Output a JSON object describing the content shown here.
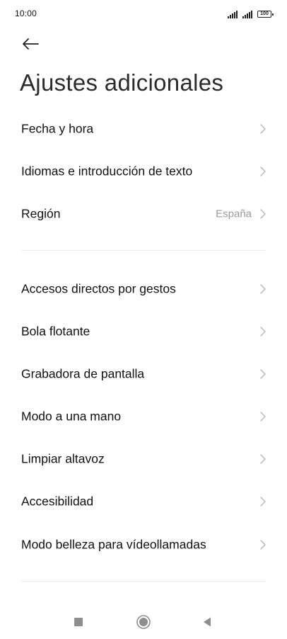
{
  "status_bar": {
    "time": "10:00",
    "battery_level": "100",
    "icons": [
      "signal-icon",
      "signal-icon",
      "battery-icon"
    ]
  },
  "header": {
    "back_icon": "arrow-left-icon",
    "title": "Ajustes adicionales"
  },
  "groups": [
    {
      "items": [
        {
          "label": "Fecha y hora",
          "value": ""
        },
        {
          "label": "Idiomas e introducción de texto",
          "value": ""
        },
        {
          "label": "Región",
          "value": "España"
        }
      ]
    },
    {
      "items": [
        {
          "label": "Accesos directos por gestos",
          "value": ""
        },
        {
          "label": "Bola flotante",
          "value": ""
        },
        {
          "label": "Grabadora de pantalla",
          "value": ""
        },
        {
          "label": "Modo a una mano",
          "value": ""
        },
        {
          "label": "Limpiar altavoz",
          "value": ""
        },
        {
          "label": "Accesibilidad",
          "value": ""
        },
        {
          "label": "Modo belleza para vídeollamadas",
          "value": ""
        }
      ]
    }
  ],
  "nav_bar": {
    "icons": [
      "recents-square-icon",
      "home-circle-icon",
      "back-triangle-icon"
    ]
  },
  "colors": {
    "text": "#111111",
    "secondary_text": "#9a9a9a",
    "chevron": "#b5b5b5",
    "divider": "#ececec",
    "nav_icon": "#8e8e8e"
  }
}
